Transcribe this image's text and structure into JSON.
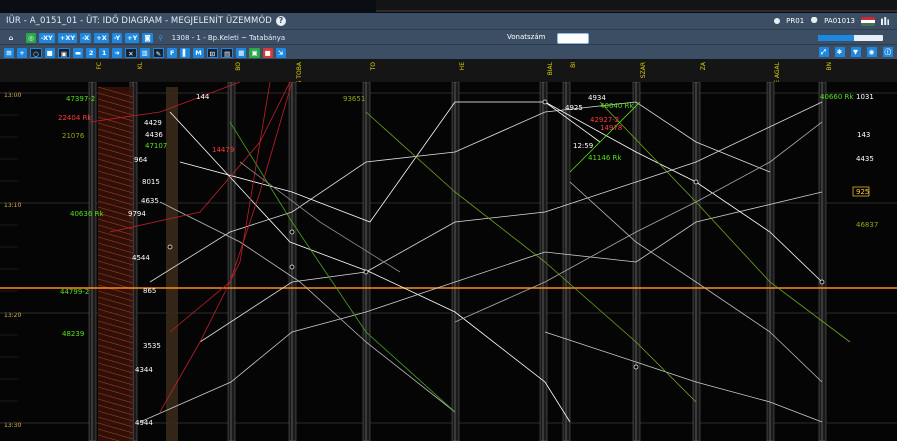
{
  "window": {
    "title": "IÜR - A_0151_01 - ÜT: IDŐ DIAGRAM - MEGJELENÍT ÜZEMMÓD",
    "user_code": "PR01",
    "user_name": "PA01013"
  },
  "toolbar": {
    "buttons_row1": [
      "-XY",
      "+XY",
      "-X",
      "+X",
      "-Y",
      "+Y"
    ],
    "route_text": "1308 - 1 - Bp.Keleti ~ Tatabánya",
    "vonatszam_label": "Vonatszám",
    "vonatszam_value": "",
    "progress": 0.55
  },
  "stations": [
    "FC",
    "KL",
    "BO",
    "BOJS\nTOBÁ",
    "TÓ",
    "HE",
    "BIAL",
    "BI",
    "SZÁR",
    "ZÁ",
    "ÁNE\nAGAL",
    "BN"
  ],
  "time_labels": [
    "13:00",
    "13:10",
    "13:20",
    "13:30"
  ],
  "train_labels": [
    {
      "text": "47397-2",
      "color": "#58e01a"
    },
    {
      "text": "22404 Rk",
      "color": "#ff3b3b"
    },
    {
      "text": "21076",
      "color": "#9aa41a"
    },
    {
      "text": "40636 Rk",
      "color": "#58e01a"
    },
    {
      "text": "44799-2",
      "color": "#58e01a"
    },
    {
      "text": "48239",
      "color": "#58e01a"
    },
    {
      "text": "144",
      "color": "#ffffff"
    },
    {
      "text": "4429",
      "color": "#ffffff"
    },
    {
      "text": "4436",
      "color": "#ffffff"
    },
    {
      "text": "47107",
      "color": "#58e01a"
    },
    {
      "text": "964",
      "color": "#ffffff"
    },
    {
      "text": "8015",
      "color": "#ffffff"
    },
    {
      "text": "4635",
      "color": "#ffffff"
    },
    {
      "text": "9794",
      "color": "#ffffff"
    },
    {
      "text": "4544",
      "color": "#ffffff"
    },
    {
      "text": "865",
      "color": "#ffffff"
    },
    {
      "text": "3535",
      "color": "#ffffff"
    },
    {
      "text": "4344",
      "color": "#ffffff"
    },
    {
      "text": "4944",
      "color": "#ffffff"
    },
    {
      "text": "4934",
      "color": "#ffffff"
    },
    {
      "text": "40640 Rk",
      "color": "#58e01a"
    },
    {
      "text": "4925",
      "color": "#ffffff"
    },
    {
      "text": "42927-2",
      "color": "#ff3b3b"
    },
    {
      "text": "14978",
      "color": "#ff3b3b"
    },
    {
      "text": "41146 Rk",
      "color": "#58e01a"
    },
    {
      "text": "40660 Rk",
      "color": "#58e01a"
    },
    {
      "text": "1031",
      "color": "#ffffff"
    },
    {
      "text": "143",
      "color": "#ffffff"
    },
    {
      "text": "4435",
      "color": "#ffffff"
    },
    {
      "text": "925",
      "color": "#ffcc33"
    },
    {
      "text": "46837",
      "color": "#9aa41a"
    },
    {
      "text": "93651",
      "color": "#9aa41a"
    },
    {
      "text": "14479",
      "color": "#ff3b3b"
    },
    {
      "text": "12:59",
      "color": "#ffffff"
    }
  ],
  "colors": {
    "accent": "#1e87e0",
    "header_bg": "#3b4e63",
    "time_marker": "#ff8c1a"
  }
}
